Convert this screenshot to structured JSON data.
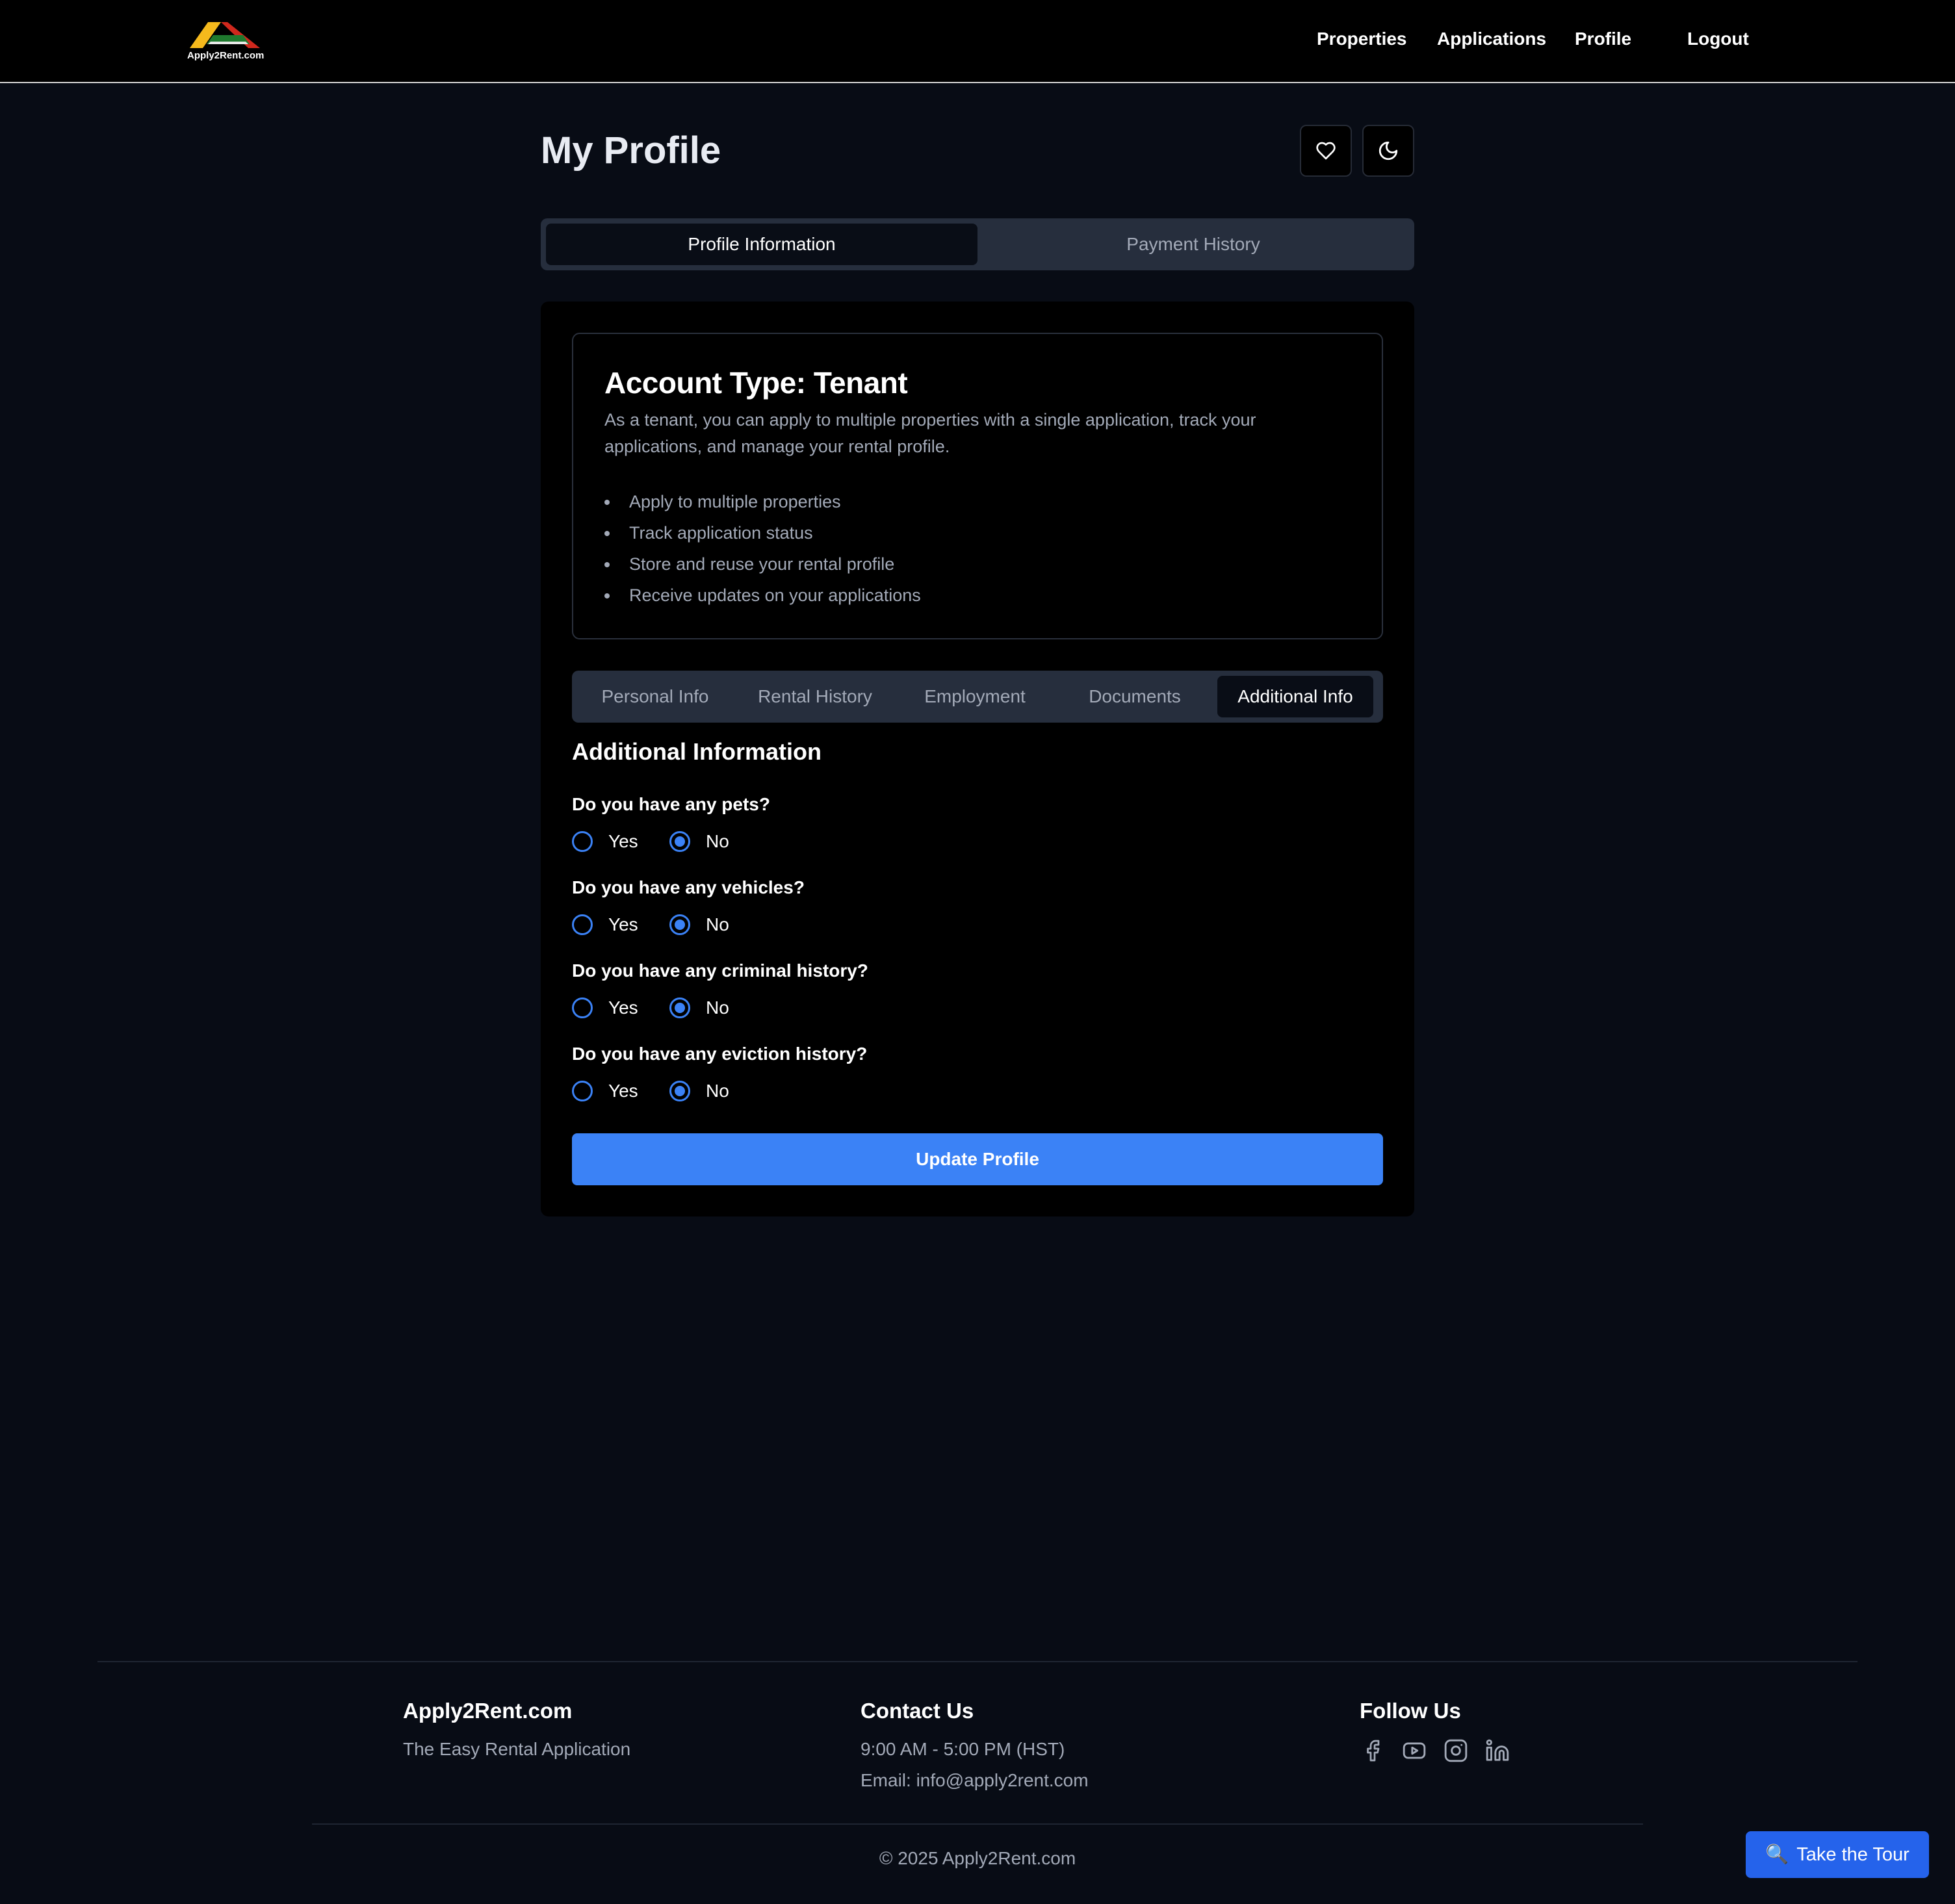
{
  "brand": {
    "logo_text": "Apply2Rent.com",
    "colors": {
      "yellow": "#f5b91c",
      "red": "#d0281d",
      "green": "#1f7a2e"
    }
  },
  "nav": {
    "items": [
      {
        "label": "Properties"
      },
      {
        "label": "Applications"
      },
      {
        "label": "Profile"
      },
      {
        "label": "Logout"
      }
    ]
  },
  "header": {
    "title": "My Profile",
    "favorite_icon": "heart-icon",
    "theme_icon": "moon-icon"
  },
  "main_tabs": [
    {
      "label": "Profile Information",
      "active": true
    },
    {
      "label": "Payment History",
      "active": false
    }
  ],
  "account": {
    "title": "Account Type: Tenant",
    "description": "As a tenant, you can apply to multiple properties with a single application, track your applications, and manage your rental profile.",
    "features": [
      "Apply to multiple properties",
      "Track application status",
      "Store and reuse your rental profile",
      "Receive updates on your applications"
    ]
  },
  "sub_tabs": [
    {
      "label": "Personal Info",
      "active": false
    },
    {
      "label": "Rental History",
      "active": false
    },
    {
      "label": "Employment",
      "active": false
    },
    {
      "label": "Documents",
      "active": false
    },
    {
      "label": "Additional Info",
      "active": true
    }
  ],
  "additional": {
    "title": "Additional Information",
    "questions": [
      {
        "label": "Do you have any pets?",
        "yes": "Yes",
        "no": "No",
        "selected": "No"
      },
      {
        "label": "Do you have any vehicles?",
        "yes": "Yes",
        "no": "No",
        "selected": "No"
      },
      {
        "label": "Do you have any criminal history?",
        "yes": "Yes",
        "no": "No",
        "selected": "No"
      },
      {
        "label": "Do you have any eviction history?",
        "yes": "Yes",
        "no": "No",
        "selected": "No"
      }
    ],
    "submit_label": "Update Profile"
  },
  "footer": {
    "brand_title": "Apply2Rent.com",
    "tagline": "The Easy Rental Application",
    "contact_title": "Contact Us",
    "hours": "9:00 AM - 5:00 PM (HST)",
    "email": "Email: info@apply2rent.com",
    "follow_title": "Follow Us",
    "social_icons": [
      "facebook-icon",
      "youtube-icon",
      "instagram-icon",
      "linkedin-icon"
    ],
    "copyright": "© 2025 Apply2Rent.com"
  },
  "tour": {
    "icon": "🔍",
    "label": "Take the Tour"
  },
  "colors": {
    "accent": "#3b82f6",
    "page_bg": "#080c15",
    "card_bg": "#000000",
    "muted_text": "#a3aab8"
  }
}
